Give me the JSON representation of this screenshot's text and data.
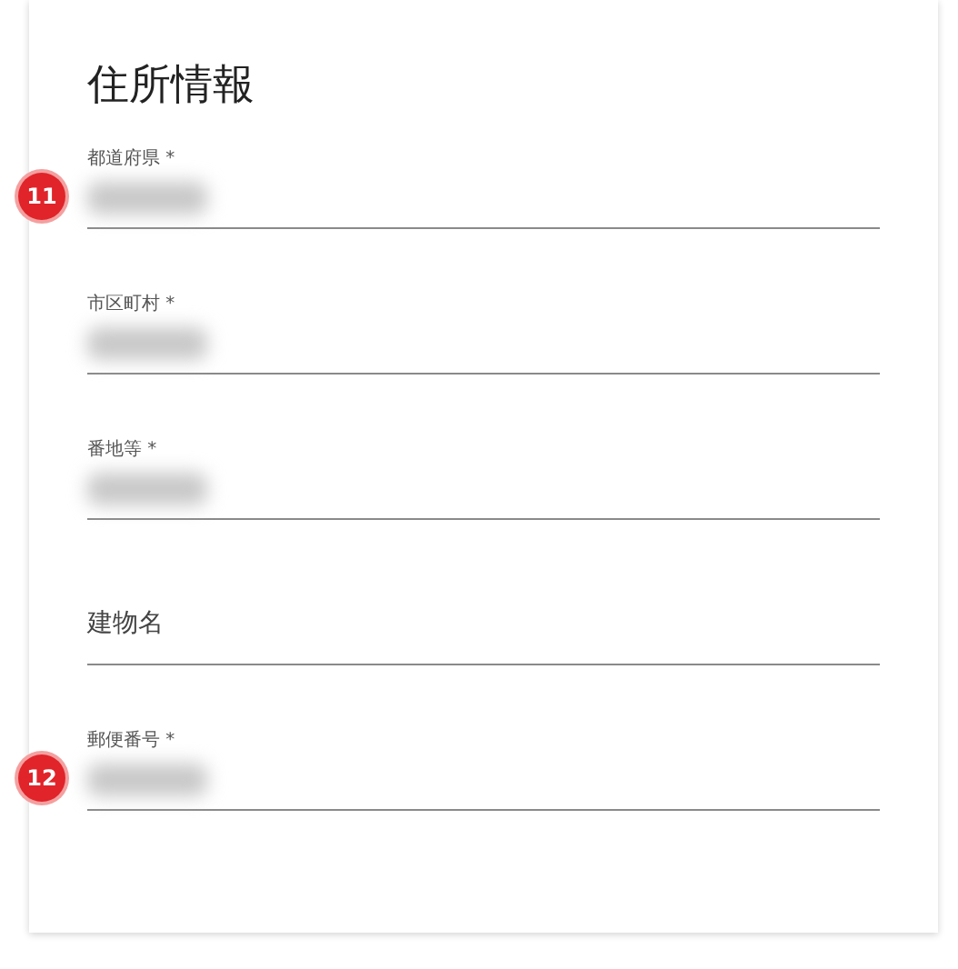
{
  "title": "住所情報",
  "fields": [
    {
      "label": "都道府県 *",
      "filled": true,
      "badge": "11"
    },
    {
      "label": "市区町村 *",
      "filled": true
    },
    {
      "label": "番地等 *",
      "filled": true
    },
    {
      "label": "建物名",
      "filled": false
    },
    {
      "label": "郵便番号 *",
      "filled": true,
      "badge": "12"
    }
  ]
}
